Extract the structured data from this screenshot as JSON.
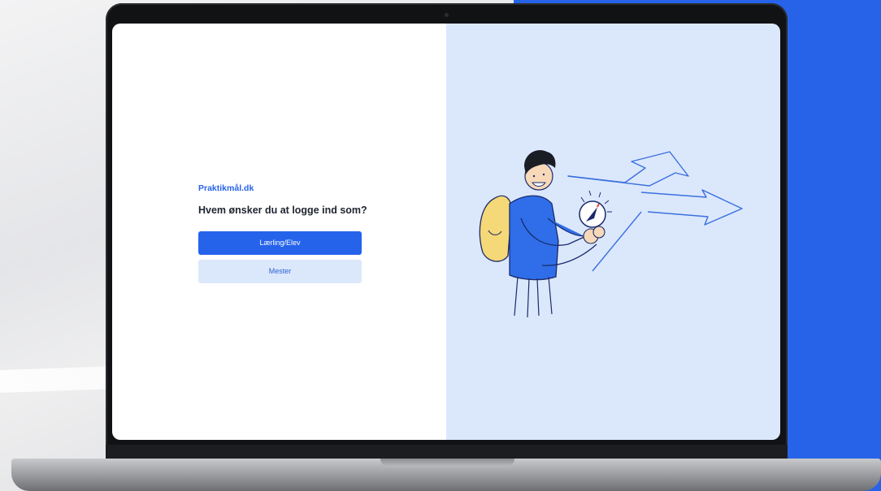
{
  "brand": {
    "name": "Praktikmål.dk"
  },
  "login": {
    "question": "Hvem ønsker du at logge ind som?",
    "primary_label": "Lærling/Elev",
    "secondary_label": "Mester"
  },
  "colors": {
    "accent": "#2563eb",
    "accent_light": "#dbe8fc",
    "backdrop_blue": "#2663e8",
    "text_dark": "#1f2430"
  }
}
